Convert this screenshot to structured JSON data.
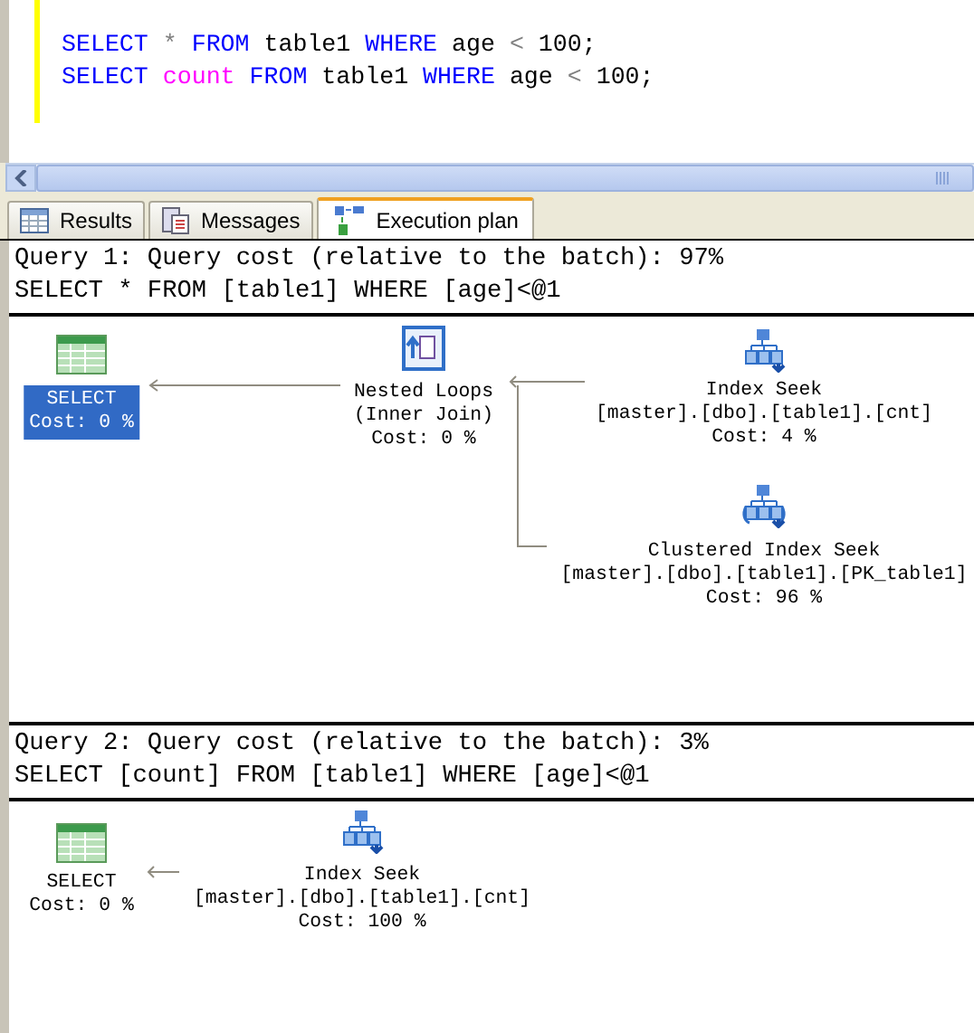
{
  "editor": {
    "lines": [
      [
        {
          "text": "SELECT",
          "kind": "keyword"
        },
        {
          "text": "*",
          "kind": "operator"
        },
        {
          "text": "FROM",
          "kind": "keyword"
        },
        {
          "text": "table1",
          "kind": "plain"
        },
        {
          "text": "WHERE",
          "kind": "keyword"
        },
        {
          "text": "age",
          "kind": "plain"
        },
        {
          "text": "<",
          "kind": "operator"
        },
        {
          "text": "100;",
          "kind": "plain"
        }
      ],
      [
        {
          "text": "SELECT",
          "kind": "keyword"
        },
        {
          "text": "count",
          "kind": "function"
        },
        {
          "text": "FROM",
          "kind": "keyword"
        },
        {
          "text": "table1",
          "kind": "plain"
        },
        {
          "text": "WHERE",
          "kind": "keyword"
        },
        {
          "text": "age",
          "kind": "plain"
        },
        {
          "text": "<",
          "kind": "operator"
        },
        {
          "text": "100;",
          "kind": "plain"
        }
      ]
    ]
  },
  "tabs": [
    {
      "label": "Results",
      "kind": "grid",
      "selected": false
    },
    {
      "label": "Messages",
      "kind": "messages",
      "selected": false
    },
    {
      "label": "Execution plan",
      "kind": "plan",
      "selected": true
    }
  ],
  "plans": [
    {
      "header": "Query 1: Query cost (relative to the batch): 97%",
      "statement": "SELECT * FROM [table1] WHERE [age]<@1",
      "nodes": [
        {
          "kind": "select",
          "selected": true,
          "lines": [
            "SELECT",
            "Cost: 0 %"
          ]
        },
        {
          "kind": "nested-loops",
          "selected": false,
          "lines": [
            "Nested Loops",
            "(Inner Join)",
            "Cost: 0 %"
          ]
        },
        {
          "kind": "index-seek",
          "selected": false,
          "lines": [
            "Index Seek",
            "[master].[dbo].[table1].[cnt]",
            "Cost: 4 %"
          ]
        },
        {
          "kind": "clustered-index-seek",
          "selected": false,
          "lines": [
            "Clustered Index Seek",
            "[master].[dbo].[table1].[PK_table1]",
            "Cost: 96 %"
          ]
        }
      ]
    },
    {
      "header": "Query 2: Query cost (relative to the batch): 3%",
      "statement": "SELECT [count] FROM [table1] WHERE [age]<@1",
      "nodes": [
        {
          "kind": "select",
          "selected": false,
          "lines": [
            "SELECT",
            "Cost: 0 %"
          ]
        },
        {
          "kind": "index-seek",
          "selected": false,
          "lines": [
            "Index Seek",
            "[master].[dbo].[table1].[cnt]",
            "Cost: 100 %"
          ]
        }
      ]
    }
  ]
}
